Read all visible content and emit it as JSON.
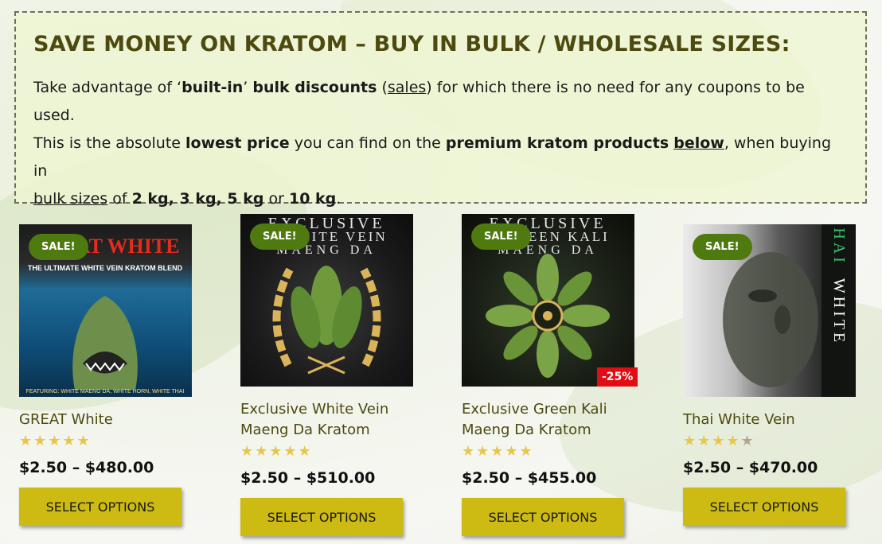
{
  "banner": {
    "heading": "SAVE MONEY ON KRATOM – BUY IN BULK / WHOLESALE SIZES:",
    "p1_a": "Take advantage of ‘",
    "p1_b": "built-in",
    "p1_c": "’ ",
    "p1_d": "bulk discounts",
    "p1_e": " (",
    "p1_f": "sales",
    "p1_g": ") for which there is no need for any coupons to be used.",
    "p2_a": "This is the absolute ",
    "p2_b": "lowest price",
    "p2_c": " you can find on the ",
    "p2_d": "premium kratom products",
    "p2_e": " ",
    "p2_f": "below",
    "p2_g": ", when buying in",
    "p3_a": "bulk sizes",
    "p3_b": " of ",
    "p3_c": "2 kg, 3 kg, 5 kg",
    "p3_d": " or ",
    "p3_e": "10 kg",
    "p3_f": "."
  },
  "products": [
    {
      "title_line1": "GREAT White",
      "title_line2": "",
      "badge": "SALE!",
      "discount": "",
      "rating": 5,
      "price": "$2.50 – $480.00",
      "button": "SELECT OPTIONS",
      "image_text_top": "GREAT WHITE",
      "image_text_sub": "THE ULTIMATE WHITE VEIN KRATOM BLEND",
      "image_text_bottom": "FEATURING: WHITE MAENG DA, WHITE HORN, WHITE THAI"
    },
    {
      "title_line1": "Exclusive White Vein",
      "title_line2": "Maeng Da Kratom",
      "badge": "SALE!",
      "discount": "",
      "rating": 5,
      "price": "$2.50 – $510.00",
      "button": "SELECT OPTIONS",
      "image_text_top": "EXCLUSIVE",
      "image_text_sub": "WHITE VEIN",
      "image_text_bottom": "MAENG DA"
    },
    {
      "title_line1": "Exclusive Green Kali",
      "title_line2": "Maeng Da Kratom",
      "badge": "SALE!",
      "discount": "-25%",
      "rating": 5,
      "price": "$2.50 – $455.00",
      "button": "SELECT OPTIONS",
      "image_text_top": "EXCLUSIVE",
      "image_text_sub": "GREEN KALI",
      "image_text_bottom": "MAENG DA"
    },
    {
      "title_line1": "Thai White Vein",
      "title_line2": "",
      "badge": "SALE!",
      "discount": "",
      "rating": 4.5,
      "price": "$2.50 – $470.00",
      "button": "SELECT OPTIONS",
      "image_text_top": "THAI",
      "image_text_sub": "WHITE",
      "image_text_bottom": ""
    }
  ],
  "colors": {
    "accent": "#4d4a10",
    "button": "#cdbb13",
    "sale_badge": "#4e7a0f",
    "discount_badge": "#e10c14",
    "star": "#e8c64a"
  }
}
